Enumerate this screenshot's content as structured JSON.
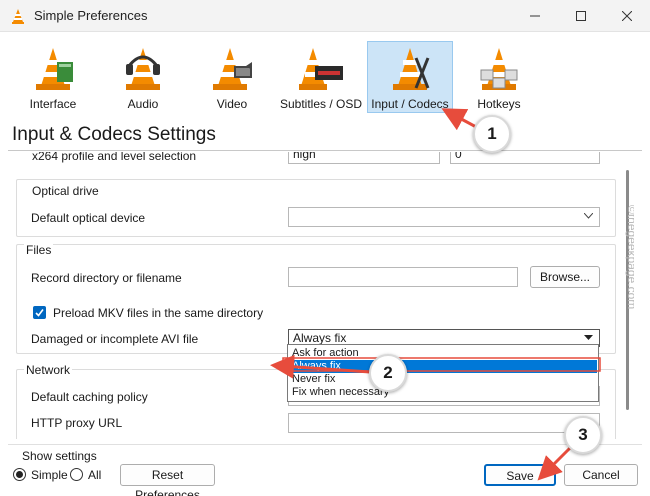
{
  "window": {
    "title": "Simple Preferences"
  },
  "toolbar": {
    "tabs": [
      {
        "label": "Interface"
      },
      {
        "label": "Audio"
      },
      {
        "label": "Video"
      },
      {
        "label": "Subtitles / OSD"
      },
      {
        "label": "Input / Codecs",
        "selected": true
      },
      {
        "label": "Hotkeys"
      }
    ]
  },
  "page": {
    "title": "Input & Codecs Settings"
  },
  "top_partial": {
    "label": "x264 profile and level selection",
    "profile_value": "high",
    "level_value": "0"
  },
  "optical": {
    "group_title": "Optical drive",
    "device_label": "Default optical device",
    "device_value": ""
  },
  "files": {
    "group_title": "Files",
    "record_label": "Record directory or filename",
    "record_value": "",
    "browse_label": "Browse...",
    "preload_label": "Preload MKV files in the same directory",
    "preload_checked": true,
    "avi_label": "Damaged or incomplete AVI file",
    "avi_value": "Always fix",
    "avi_options": [
      "Ask for action",
      "Always fix",
      "Never fix",
      "Fix when necessary"
    ]
  },
  "network": {
    "group_title": "Network",
    "caching_label": "Default caching policy",
    "caching_value": "",
    "proxy_label": "HTTP proxy URL",
    "proxy_value": ""
  },
  "footer": {
    "show_settings_label": "Show settings",
    "simple_label": "Simple",
    "all_label": "All",
    "selected_mode": "Simple",
    "reset_label": "Reset Preferences",
    "save_label": "Save",
    "cancel_label": "Cancel"
  },
  "annotations": {
    "step1": "1",
    "step2": "2",
    "step3": "3",
    "accent_color": "#e74c3c"
  },
  "watermark": "©thegeekpage.com"
}
